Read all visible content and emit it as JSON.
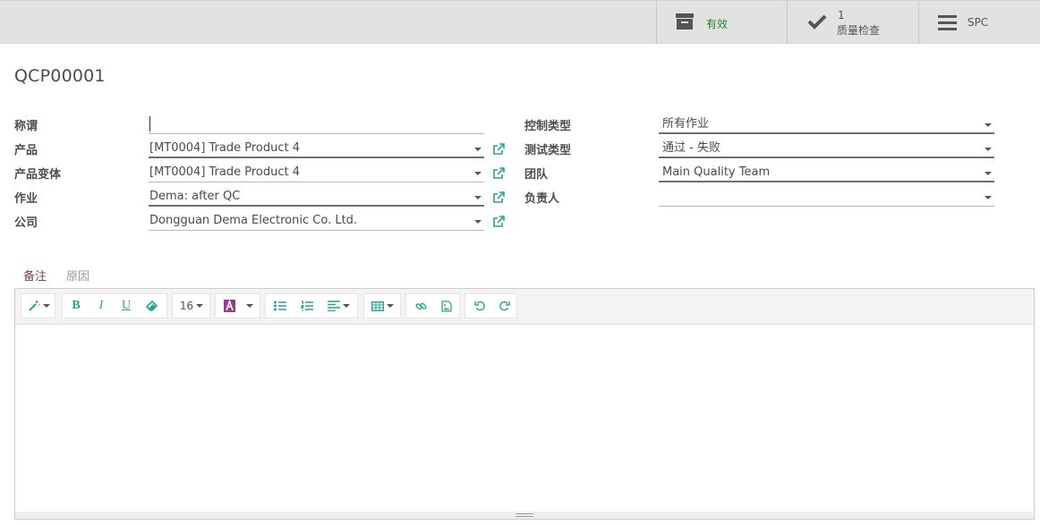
{
  "statusbar": {
    "archive_label": "有效",
    "quality_count": "1",
    "quality_label": "质量检查",
    "spc_label": "SPC"
  },
  "record": {
    "title": "QCP00001"
  },
  "form": {
    "left": [
      {
        "label": "称谓",
        "value": ""
      },
      {
        "label": "产品",
        "value": "[MT0004] Trade Product 4"
      },
      {
        "label": "产品变体",
        "value": "[MT0004] Trade Product 4"
      },
      {
        "label": "作业",
        "value": "Dema: after QC"
      },
      {
        "label": "公司",
        "value": "Dongguan Dema Electronic Co. Ltd."
      }
    ],
    "right": [
      {
        "label": "控制类型",
        "value": "所有作业"
      },
      {
        "label": "测试类型",
        "value": "通过 - 失败"
      },
      {
        "label": "团队",
        "value": "Main Quality Team"
      },
      {
        "label": "负责人",
        "value": ""
      }
    ]
  },
  "tabs": [
    {
      "label": "备注",
      "active": true
    },
    {
      "label": "原因",
      "active": false
    }
  ],
  "editor": {
    "font_size": "16"
  },
  "colors": {
    "accent": "#2aa38f",
    "active_tab": "#7c3c5a",
    "archive_text": "#2e7d32",
    "count_text": "#7c3c5a"
  }
}
